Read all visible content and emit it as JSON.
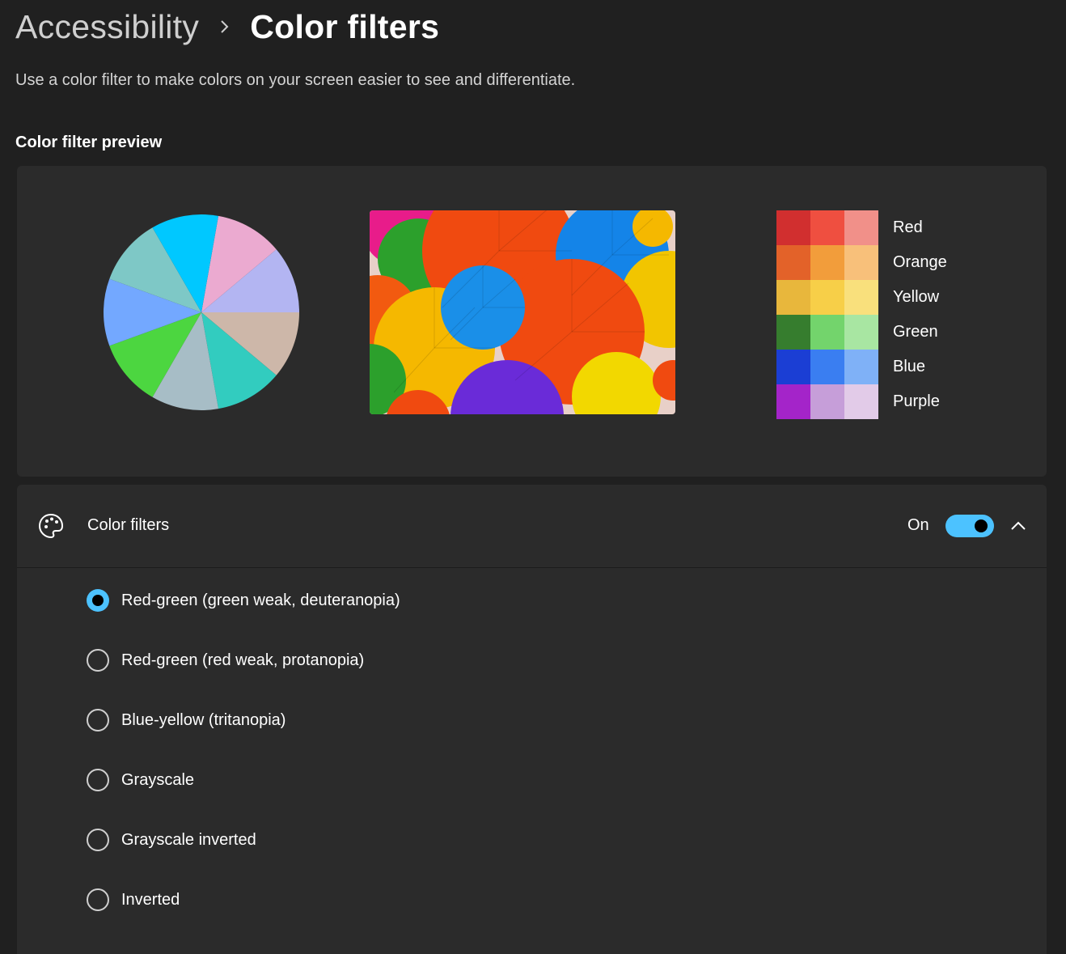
{
  "breadcrumb": {
    "parent": "Accessibility",
    "current": "Color filters"
  },
  "description": "Use a color filter to make colors on your screen easier to see and differentiate.",
  "preview": {
    "title": "Color filter preview",
    "pie_slice_colors": [
      "#ebaad0",
      "#b3b5f2",
      "#cdb7a9",
      "#32ccbf",
      "#a7bdc6",
      "#4cd640",
      "#73a8ff",
      "#7ec8c6",
      "#00c8ff"
    ],
    "swatches": [
      {
        "label": "Red",
        "colors": [
          "#d12f2f",
          "#ef4f40",
          "#f19089"
        ]
      },
      {
        "label": "Orange",
        "colors": [
          "#e36229",
          "#f29d3b",
          "#f8c07a"
        ]
      },
      {
        "label": "Yellow",
        "colors": [
          "#e8b73c",
          "#f7cf48",
          "#f9e07c"
        ]
      },
      {
        "label": "Green",
        "colors": [
          "#367d2e",
          "#73d46c",
          "#a8e6a2"
        ]
      },
      {
        "label": "Blue",
        "colors": [
          "#1b3ed4",
          "#3a7ef1",
          "#7fb1f7"
        ]
      },
      {
        "label": "Purple",
        "colors": [
          "#a424c9",
          "#c69ed9",
          "#e2cbe8"
        ]
      }
    ]
  },
  "filters": {
    "title": "Color filters",
    "toggle_state": "On",
    "toggle_on": true,
    "accent_color": "#4cc2ff",
    "options": [
      {
        "label": "Red-green (green weak, deuteranopia)",
        "selected": true
      },
      {
        "label": "Red-green (red weak, protanopia)",
        "selected": false
      },
      {
        "label": "Blue-yellow (tritanopia)",
        "selected": false
      },
      {
        "label": "Grayscale",
        "selected": false
      },
      {
        "label": "Grayscale inverted",
        "selected": false
      },
      {
        "label": "Inverted",
        "selected": false
      }
    ]
  }
}
